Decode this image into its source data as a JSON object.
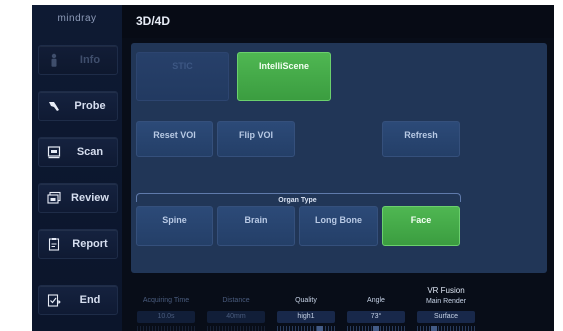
{
  "brand": "mindray",
  "header": {
    "title": "3D/4D"
  },
  "sidebar": {
    "items": [
      {
        "label": "Info",
        "icon": "person-icon",
        "enabled": false
      },
      {
        "label": "Probe",
        "icon": "probe-icon",
        "enabled": true
      },
      {
        "label": "Scan",
        "icon": "scan-icon",
        "enabled": true
      },
      {
        "label": "Review",
        "icon": "review-icon",
        "enabled": true
      },
      {
        "label": "Report",
        "icon": "report-icon",
        "enabled": true
      },
      {
        "label": "End",
        "icon": "end-exam-icon",
        "enabled": true
      }
    ]
  },
  "touch_panel": {
    "stic": "STIC",
    "intelliscene": "IntelliScene",
    "reset_voi": "Reset VOI",
    "flip_voi": "Flip VOI",
    "refresh": "Refresh",
    "organ_type": {
      "label": "Organ Type",
      "options": [
        "Spine",
        "Brain",
        "Long Bone",
        "Face"
      ],
      "selected": "Face"
    }
  },
  "status_bar": {
    "acquiring_time": {
      "caption": "Acquiring Time",
      "value": "10.0s",
      "enabled": false
    },
    "distance": {
      "caption": "Distance",
      "value": "40mm",
      "enabled": false
    },
    "quality": {
      "caption": "Quality",
      "value": "high1",
      "enabled": true
    },
    "angle": {
      "caption": "Angle",
      "value": "73°",
      "enabled": true
    },
    "vr_fusion": {
      "title": "VR Fusion",
      "caption": "Main Render",
      "value": "Surface",
      "enabled": true
    }
  },
  "colors": {
    "accent_green": "#4fb752",
    "panel_blue": "#213657",
    "button_blue": "#2c4a78",
    "background": "#080d18"
  }
}
